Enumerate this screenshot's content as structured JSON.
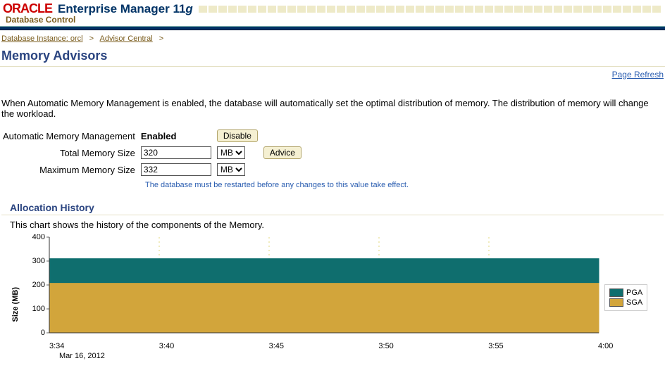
{
  "header": {
    "oracle": "ORACLE",
    "em_prefix": "Enterprise Manager 11",
    "em_suffix": "g",
    "subtitle": "Database Control"
  },
  "breadcrumb": {
    "items": [
      {
        "label": "Database Instance: orcl"
      },
      {
        "label": "Advisor Central"
      }
    ],
    "sep": ">"
  },
  "page_title": "Memory Advisors",
  "refresh_link": "Page Refresh",
  "intro_text": "When Automatic Memory Management is enabled, the database will automatically set the optimal distribution of memory. The distribution of memory will change the workload.",
  "form": {
    "amm_label": "Automatic Memory Management",
    "amm_value": "Enabled",
    "disable_btn": "Disable",
    "total_label": "Total Memory Size",
    "total_value": "320",
    "max_label": "Maximum Memory Size",
    "max_value": "332",
    "unit": "MB",
    "advice_btn": "Advice",
    "restart_note": "The database must be restarted before any changes to this value take effect."
  },
  "allocation": {
    "title": "Allocation History",
    "desc": "This chart shows the history of the components of the Memory.",
    "ylabel": "Size (MB)",
    "date": "Mar 16, 2012"
  },
  "legend": {
    "pga": "PGA",
    "sga": "SGA"
  },
  "chart_data": {
    "type": "area",
    "x": [
      "3:34",
      "3:40",
      "3:45",
      "3:50",
      "3:55",
      "4:00"
    ],
    "series": [
      {
        "name": "SGA",
        "values": [
          210,
          210,
          210,
          210,
          210,
          210
        ],
        "color": "#d2a53b"
      },
      {
        "name": "PGA",
        "values": [
          100,
          100,
          100,
          100,
          100,
          100
        ],
        "color": "#0f6e6e"
      }
    ],
    "ylim": [
      0,
      400
    ],
    "yticks": [
      0,
      100,
      200,
      300,
      400
    ],
    "ylabel": "Size (MB)"
  }
}
